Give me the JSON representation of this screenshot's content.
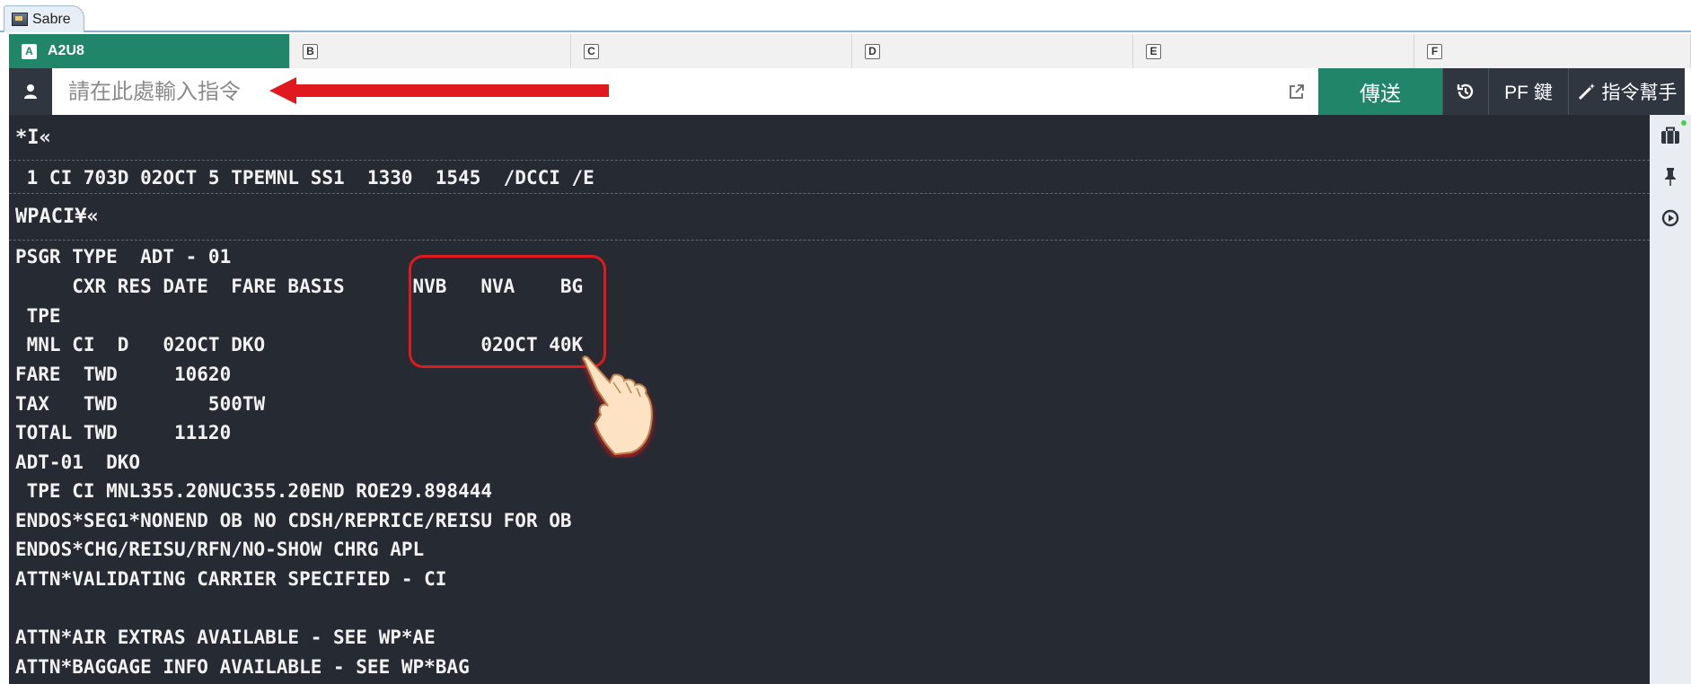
{
  "window": {
    "title": "Sabre"
  },
  "sessions": [
    {
      "key": "A",
      "label": "A2U8",
      "active": true
    },
    {
      "key": "B",
      "label": ""
    },
    {
      "key": "C",
      "label": ""
    },
    {
      "key": "D",
      "label": ""
    },
    {
      "key": "E",
      "label": ""
    },
    {
      "key": "F",
      "label": ""
    }
  ],
  "command_bar": {
    "placeholder": "請在此處輸入指令",
    "send_label": "傳送",
    "pf_label": "PF 鍵",
    "helper_label": "指令幫手"
  },
  "terminal": {
    "command1": "*I«",
    "itinerary": " 1 CI 703D 02OCT 5 TPEMNL SS1  1330  1545  /DCCI /E",
    "command2": "WPACI¥«",
    "lines": [
      "PSGR TYPE  ADT - 01",
      "     CXR RES DATE  FARE BASIS      NVB   NVA    BG",
      " TPE",
      " MNL CI  D   02OCT DKO                   02OCT 40K",
      "FARE  TWD     10620",
      "TAX   TWD        500TW",
      "TOTAL TWD     11120",
      "ADT-01  DKO",
      " TPE CI MNL355.20NUC355.20END ROE29.898444",
      "ENDOS*SEG1*NONEND OB NO CDSH/REPRICE/REISU FOR OB",
      "ENDOS*CHG/REISU/RFN/NO-SHOW CHRG APL",
      "ATTN*VALIDATING CARRIER SPECIFIED - CI",
      "",
      "ATTN*AIR EXTRAS AVAILABLE - SEE WP*AE",
      "ATTN*BAGGAGE INFO AVAILABLE - SEE WP*BAG"
    ]
  },
  "colors": {
    "accent": "#21856a",
    "terminal_bg": "#262a32",
    "highlight": "#e0191f"
  },
  "icons": {
    "user": "user-icon",
    "external": "external-link-icon",
    "history": "history-icon",
    "helper": "magic-wand-icon",
    "sidebar": [
      "briefcase-icon",
      "pin-icon",
      "play-circle-icon"
    ]
  }
}
